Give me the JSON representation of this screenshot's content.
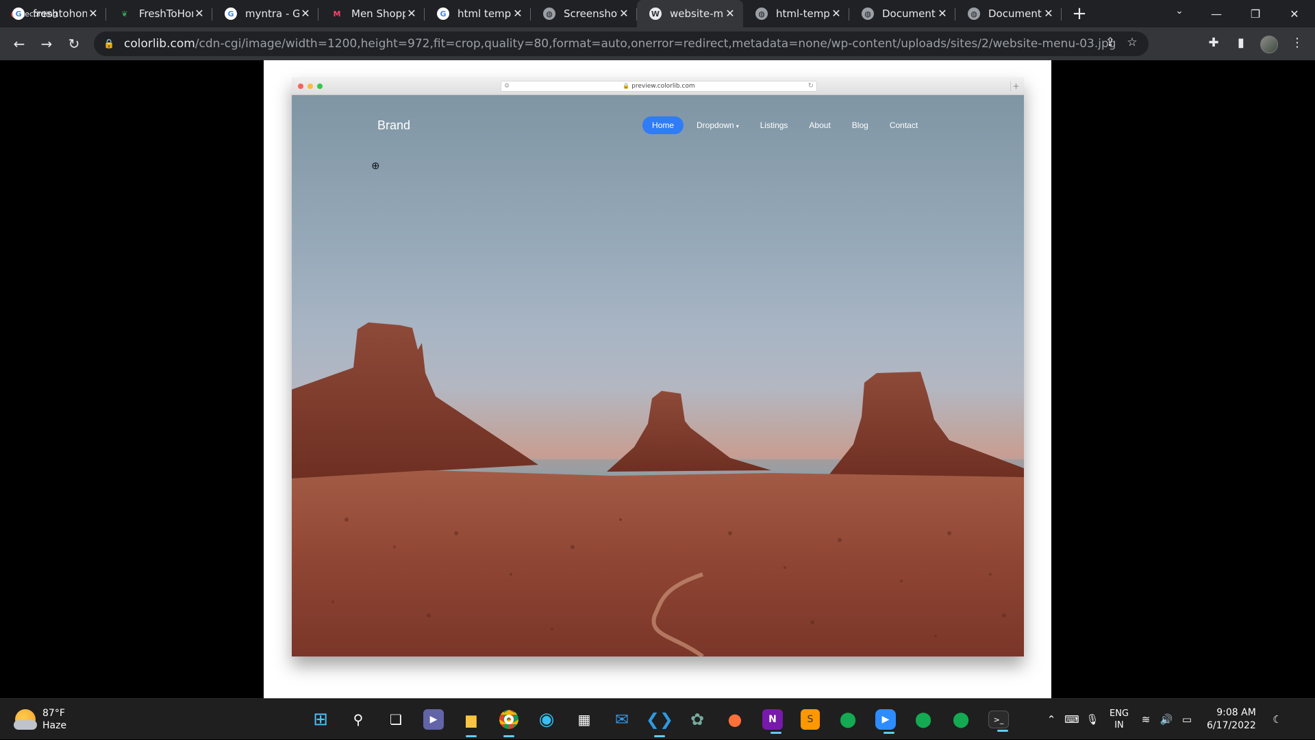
{
  "recording": {
    "label": "Recording"
  },
  "tabs": [
    {
      "title": "freshtohom",
      "favicon": "google-icon",
      "active": false
    },
    {
      "title": "FreshToHon",
      "favicon": "leaf-icon",
      "active": false
    },
    {
      "title": "myntra - Gc",
      "favicon": "google-icon",
      "active": false
    },
    {
      "title": "Men Shopp",
      "favicon": "myntra-icon",
      "active": false
    },
    {
      "title": "html templa",
      "favicon": "google-icon",
      "active": false
    },
    {
      "title": "Screenshot",
      "favicon": "globe-icon",
      "active": false
    },
    {
      "title": "website-me",
      "favicon": "wordpress-icon",
      "active": true
    },
    {
      "title": "html-templ",
      "favicon": "globe-icon",
      "active": false
    },
    {
      "title": "Document",
      "favicon": "globe-icon",
      "active": false
    },
    {
      "title": "Document",
      "favicon": "globe-icon",
      "active": false
    }
  ],
  "address_bar": {
    "domain": "colorlib.com",
    "path": "/cdn-cgi/image/width=1200,height=972,fit=crop,quality=80,format=auto,onerror=redirect,metadata=none/wp-content/uploads/sites/2/website-menu-03.jpg"
  },
  "mockup": {
    "url": "preview.colorlib.com",
    "brand": "Brand",
    "nav": [
      {
        "label": "Home",
        "active": true
      },
      {
        "label": "Dropdown",
        "has_caret": true
      },
      {
        "label": "Listings"
      },
      {
        "label": "About"
      },
      {
        "label": "Blog"
      },
      {
        "label": "Contact"
      }
    ],
    "accent": "#2f7cf6"
  },
  "taskbar": {
    "weather": {
      "temp": "87°F",
      "condition": "Haze"
    },
    "apps": [
      "start-icon",
      "search-icon",
      "task-view-icon",
      "teams-icon",
      "file-explorer-icon",
      "chrome-icon",
      "edge-icon",
      "store-icon",
      "mail-icon",
      "vscode-icon",
      "chatgpt-icon",
      "firefox-icon",
      "onenote-icon",
      "sublime-icon",
      "mongodb-icon",
      "zoom-icon",
      "mongodb-icon",
      "mongodb-icon",
      "terminal-icon"
    ],
    "language": {
      "lang": "ENG",
      "region": "IN"
    },
    "clock": {
      "time": "9:08 AM",
      "date": "6/17/2022"
    }
  }
}
